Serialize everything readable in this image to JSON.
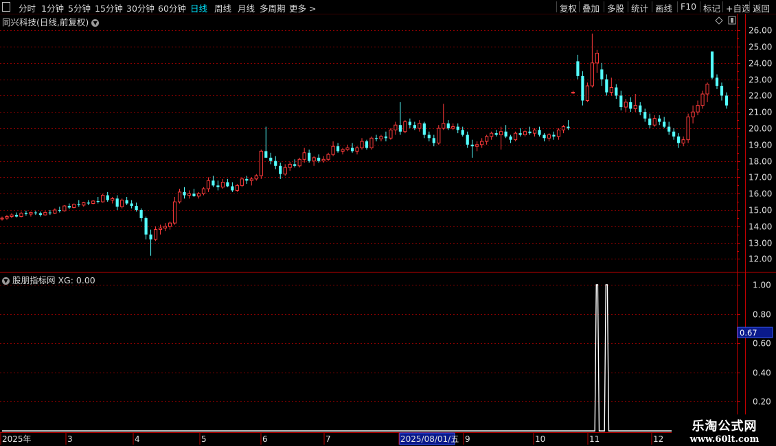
{
  "toolbar": {
    "left": [
      "分时",
      "1分钟",
      "5分钟",
      "15分钟",
      "30分钟",
      "60分钟",
      "日线",
      "周线",
      "月线",
      "多周期",
      "更多 >"
    ],
    "active": "日线",
    "right": [
      "复权",
      "叠加",
      "多股",
      "统计",
      "画线",
      "F10",
      "标记",
      "+自选",
      "返回"
    ]
  },
  "main_panel": {
    "title": "同兴科技(日线,前复权)"
  },
  "sub_panel": {
    "title": "股朋指标网",
    "xg_label": "XG: 0.00"
  },
  "bottom_axis": {
    "date_labels": [
      "2025年",
      "3",
      "4",
      "5",
      "6",
      "7",
      "2025/08/01/五",
      "9",
      "10",
      "11",
      "12"
    ]
  },
  "logo": {
    "line1": "乐淘公式网",
    "line2": "www.60lt.com"
  },
  "colors": {
    "up": "#ff3b3b",
    "down": "#54ffff",
    "grid": "#8a0000",
    "axis": "#c00000",
    "axis_text": "#e0e0e0",
    "cursor_bg": "#0a1a8c"
  },
  "chart_data": [
    {
      "type": "candlestick",
      "title": "同兴科技(日线,前复权)",
      "ylim": [
        11.6,
        26.3
      ],
      "yticks": [
        12.0,
        13.0,
        14.0,
        15.0,
        16.0,
        17.0,
        18.0,
        19.0,
        20.0,
        21.0,
        22.0,
        23.0,
        24.0,
        25.0,
        26.0
      ],
      "ytick_labels": [
        "12.00",
        "13.00",
        "14.00",
        "15.00",
        "16.00",
        "17.00",
        "18.00",
        "19.00",
        "20.00",
        "21.00",
        "22.00",
        "23.00",
        "24.00",
        "25.00",
        "26.00"
      ],
      "series": [
        {
          "ohlc": [
            [
              14.45,
              14.6,
              14.35,
              14.5
            ],
            [
              14.5,
              14.7,
              14.4,
              14.6
            ],
            [
              14.6,
              14.8,
              14.5,
              14.7
            ],
            [
              14.7,
              14.85,
              14.55,
              14.6
            ],
            [
              14.6,
              14.9,
              14.55,
              14.8
            ],
            [
              14.8,
              14.95,
              14.65,
              14.75
            ],
            [
              14.75,
              14.9,
              14.6,
              14.85
            ],
            [
              14.85,
              14.95,
              14.7,
              14.8
            ],
            [
              14.8,
              14.9,
              14.6,
              14.7
            ],
            [
              14.7,
              14.95,
              14.65,
              14.85
            ],
            [
              14.85,
              15.0,
              14.7,
              14.8
            ],
            [
              14.8,
              15.1,
              14.75,
              15.0
            ],
            [
              15.0,
              15.2,
              14.85,
              14.95
            ],
            [
              14.95,
              15.3,
              14.9,
              15.25
            ],
            [
              15.25,
              15.4,
              15.05,
              15.15
            ],
            [
              15.15,
              15.4,
              15.1,
              15.35
            ],
            [
              15.35,
              15.6,
              15.2,
              15.3
            ],
            [
              15.3,
              15.5,
              15.2,
              15.45
            ],
            [
              15.45,
              15.6,
              15.3,
              15.4
            ],
            [
              15.4,
              15.6,
              15.35,
              15.55
            ],
            [
              15.55,
              15.8,
              15.4,
              15.5
            ],
            [
              15.5,
              16.0,
              15.45,
              15.9
            ],
            [
              15.9,
              16.1,
              15.5,
              15.6
            ],
            [
              15.6,
              15.8,
              15.4,
              15.7
            ],
            [
              15.7,
              15.9,
              15.0,
              15.2
            ],
            [
              15.2,
              15.7,
              15.1,
              15.6
            ],
            [
              15.6,
              15.8,
              15.3,
              15.4
            ],
            [
              15.4,
              15.6,
              15.1,
              15.25
            ],
            [
              15.25,
              15.45,
              14.9,
              15.0
            ],
            [
              15.0,
              15.1,
              14.3,
              14.5
            ],
            [
              14.5,
              14.6,
              13.2,
              13.5
            ],
            [
              13.5,
              13.8,
              12.2,
              13.2
            ],
            [
              13.2,
              14.0,
              13.1,
              13.8
            ],
            [
              13.8,
              14.1,
              13.5,
              13.9
            ],
            [
              13.9,
              14.2,
              13.7,
              14.0
            ],
            [
              14.0,
              14.3,
              13.8,
              14.2
            ],
            [
              14.2,
              15.8,
              14.1,
              15.5
            ],
            [
              15.5,
              16.3,
              15.4,
              16.1
            ],
            [
              16.1,
              16.4,
              15.7,
              15.9
            ],
            [
              15.9,
              16.2,
              15.7,
              16.0
            ],
            [
              16.0,
              16.3,
              15.8,
              15.85
            ],
            [
              15.85,
              16.1,
              15.7,
              16.0
            ],
            [
              16.0,
              16.4,
              15.9,
              16.3
            ],
            [
              16.3,
              17.0,
              16.1,
              16.8
            ],
            [
              16.8,
              17.1,
              16.4,
              16.5
            ],
            [
              16.5,
              16.8,
              16.2,
              16.4
            ],
            [
              16.4,
              16.9,
              16.3,
              16.7
            ],
            [
              16.7,
              16.9,
              16.4,
              16.45
            ],
            [
              16.45,
              16.7,
              16.1,
              16.2
            ],
            [
              16.2,
              16.6,
              16.1,
              16.5
            ],
            [
              16.5,
              17.0,
              16.4,
              16.9
            ],
            [
              16.9,
              17.1,
              16.6,
              16.8
            ],
            [
              16.8,
              17.0,
              16.5,
              16.9
            ],
            [
              16.9,
              17.2,
              16.8,
              17.1
            ],
            [
              17.1,
              18.7,
              16.9,
              18.6
            ],
            [
              18.6,
              20.1,
              18.4,
              18.2
            ],
            [
              18.2,
              18.5,
              17.8,
              18.0
            ],
            [
              18.0,
              18.3,
              17.5,
              17.7
            ],
            [
              17.7,
              17.9,
              16.9,
              17.2
            ],
            [
              17.2,
              17.8,
              17.1,
              17.6
            ],
            [
              17.6,
              17.95,
              17.4,
              17.8
            ],
            [
              17.8,
              18.1,
              17.6,
              17.7
            ],
            [
              17.7,
              18.2,
              17.6,
              18.1
            ],
            [
              18.1,
              18.8,
              17.9,
              18.5
            ],
            [
              18.5,
              18.7,
              17.9,
              18.0
            ],
            [
              18.0,
              18.3,
              17.7,
              18.2
            ],
            [
              18.2,
              18.4,
              17.9,
              18.0
            ],
            [
              18.0,
              18.3,
              17.9,
              18.1
            ],
            [
              18.1,
              18.5,
              18.0,
              18.4
            ],
            [
              18.4,
              19.2,
              18.3,
              18.9
            ],
            [
              18.9,
              19.1,
              18.5,
              18.6
            ],
            [
              18.6,
              18.8,
              18.4,
              18.7
            ],
            [
              18.7,
              19.0,
              18.6,
              18.8
            ],
            [
              18.8,
              19.1,
              18.5,
              18.6
            ],
            [
              18.6,
              18.9,
              18.4,
              18.8
            ],
            [
              18.8,
              19.4,
              18.7,
              19.2
            ],
            [
              19.2,
              19.3,
              18.7,
              18.8
            ],
            [
              18.8,
              19.5,
              18.7,
              19.4
            ],
            [
              19.4,
              19.6,
              19.2,
              19.35
            ],
            [
              19.35,
              19.6,
              19.2,
              19.5
            ],
            [
              19.5,
              19.8,
              19.2,
              19.4
            ],
            [
              19.4,
              20.0,
              19.3,
              19.9
            ],
            [
              19.9,
              20.4,
              19.6,
              20.2
            ],
            [
              20.2,
              21.6,
              19.6,
              19.8
            ],
            [
              19.8,
              20.5,
              19.7,
              20.4
            ],
            [
              20.4,
              20.6,
              20.0,
              20.2
            ],
            [
              20.2,
              20.4,
              19.9,
              20.0
            ],
            [
              20.0,
              20.5,
              19.8,
              20.3
            ],
            [
              20.3,
              20.4,
              19.4,
              19.6
            ],
            [
              19.6,
              19.8,
              19.2,
              19.4
            ],
            [
              19.4,
              19.6,
              18.9,
              19.1
            ],
            [
              19.1,
              20.2,
              19.0,
              20.0
            ],
            [
              20.0,
              21.5,
              19.9,
              20.3
            ],
            [
              20.3,
              20.5,
              19.9,
              20.0
            ],
            [
              20.0,
              20.3,
              19.9,
              20.1
            ],
            [
              20.1,
              20.3,
              19.7,
              19.9
            ],
            [
              19.9,
              20.1,
              19.5,
              19.6
            ],
            [
              19.6,
              19.8,
              18.8,
              19.0
            ],
            [
              19.0,
              19.3,
              18.2,
              18.9
            ],
            [
              18.9,
              19.2,
              18.6,
              19.0
            ],
            [
              19.0,
              19.4,
              18.8,
              19.2
            ],
            [
              19.2,
              19.6,
              19.0,
              19.5
            ],
            [
              19.5,
              19.8,
              19.3,
              19.7
            ],
            [
              19.7,
              19.9,
              19.5,
              19.6
            ],
            [
              19.6,
              20.1,
              18.7,
              19.8
            ],
            [
              19.8,
              20.2,
              19.4,
              19.5
            ],
            [
              19.5,
              19.6,
              19.1,
              19.3
            ],
            [
              19.3,
              19.8,
              19.2,
              19.7
            ],
            [
              19.7,
              20.0,
              19.5,
              19.6
            ],
            [
              19.6,
              19.9,
              19.5,
              19.8
            ],
            [
              19.8,
              20.1,
              19.6,
              19.7
            ],
            [
              19.7,
              20.0,
              19.5,
              19.9
            ],
            [
              19.9,
              20.1,
              19.5,
              19.6
            ],
            [
              19.6,
              19.7,
              19.2,
              19.4
            ],
            [
              19.4,
              19.7,
              19.2,
              19.6
            ],
            [
              19.6,
              19.8,
              19.3,
              19.5
            ],
            [
              19.5,
              20.0,
              19.3,
              19.9
            ],
            [
              19.9,
              20.2,
              19.7,
              20.1
            ],
            [
              20.1,
              20.5,
              19.9,
              20.0
            ],
            [
              22.2,
              22.3,
              22.1,
              22.2
            ],
            [
              24.1,
              24.5,
              23.0,
              23.2
            ],
            [
              23.2,
              23.5,
              21.4,
              21.7
            ],
            [
              21.7,
              22.8,
              21.6,
              22.6
            ],
            [
              22.6,
              25.8,
              22.5,
              24.0
            ],
            [
              24.0,
              24.8,
              23.4,
              24.6
            ],
            [
              23.6,
              24.0,
              22.6,
              23.0
            ],
            [
              23.0,
              23.3,
              22.0,
              22.2
            ],
            [
              22.2,
              23.1,
              22.0,
              22.5
            ],
            [
              22.5,
              22.7,
              21.8,
              22.0
            ],
            [
              22.0,
              22.3,
              21.1,
              21.3
            ],
            [
              21.3,
              21.8,
              21.0,
              21.6
            ],
            [
              21.6,
              21.9,
              21.0,
              21.2
            ],
            [
              21.2,
              22.1,
              21.0,
              21.4
            ],
            [
              21.4,
              21.6,
              20.8,
              21.0
            ],
            [
              21.0,
              21.2,
              20.4,
              20.6
            ],
            [
              20.6,
              20.9,
              20.0,
              20.2
            ],
            [
              20.2,
              20.8,
              20.1,
              20.6
            ],
            [
              20.6,
              20.8,
              20.2,
              20.4
            ],
            [
              20.4,
              20.7,
              20.0,
              20.1
            ],
            [
              20.1,
              20.4,
              19.6,
              19.8
            ],
            [
              19.8,
              20.0,
              19.3,
              19.5
            ],
            [
              19.5,
              19.7,
              18.8,
              19.1
            ],
            [
              19.1,
              19.5,
              18.9,
              19.3
            ],
            [
              19.3,
              20.9,
              19.1,
              20.7
            ],
            [
              20.7,
              21.4,
              20.3,
              21.0
            ],
            [
              21.0,
              21.7,
              20.8,
              21.4
            ],
            [
              21.4,
              22.3,
              21.2,
              22.1
            ],
            [
              22.1,
              22.8,
              21.6,
              22.7
            ],
            [
              24.7,
              24.7,
              23.0,
              23.1
            ],
            [
              23.1,
              23.3,
              22.4,
              22.6
            ],
            [
              22.6,
              22.8,
              21.7,
              22.0
            ],
            [
              22.0,
              22.2,
              21.2,
              21.4
            ]
          ]
        }
      ]
    },
    {
      "type": "line",
      "title": "股朋指标网",
      "series": [
        {
          "name": "XG",
          "spikes_at_index": [
            124,
            126
          ]
        }
      ],
      "ylim": [
        0.0,
        1.08
      ],
      "yticks": [
        0.2,
        0.4,
        0.6,
        0.8,
        1.0
      ],
      "ytick_labels": [
        "0.20",
        "0.40",
        "0.60",
        "0.80",
        "1.00"
      ],
      "cursor_value": "0.67"
    }
  ]
}
